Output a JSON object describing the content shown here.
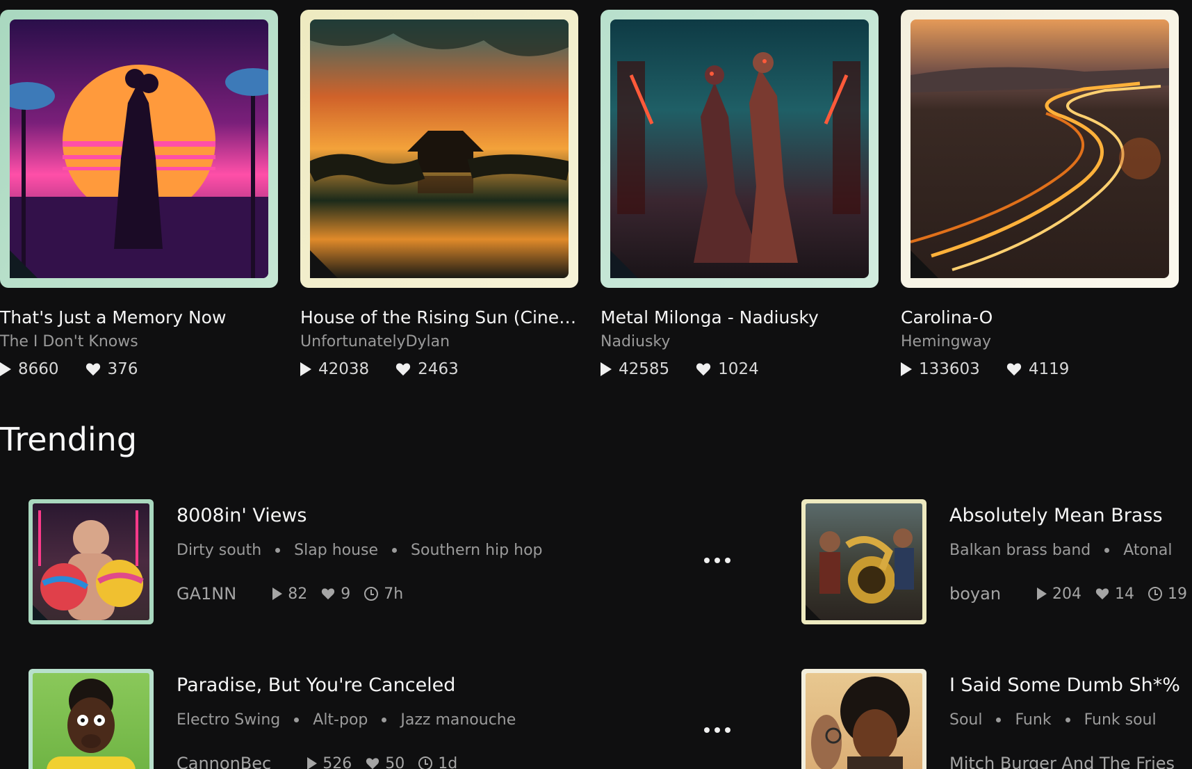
{
  "featured": [
    {
      "title": "That's Just a Memory Now",
      "artist": "The I Don't Knows",
      "plays": "8660",
      "likes": "376",
      "frame": "#a9d8bf",
      "corner": "#101a20"
    },
    {
      "title": "House of the Rising Sun (Cinem...",
      "artist": "UnfortunatelyDylan",
      "plays": "42038",
      "likes": "2463",
      "frame": "#eeeac0",
      "corner": "#121212"
    },
    {
      "title": "Metal Milonga - Nadiusky",
      "artist": "Nadiusky",
      "plays": "42585",
      "likes": "1024",
      "frame": "#b8e0cc",
      "corner": "#101820"
    },
    {
      "title": "Carolina-O",
      "artist": "Hemingway",
      "plays": "133603",
      "likes": "4119",
      "frame": "#f3efdd",
      "corner": "#121212"
    }
  ],
  "trending": {
    "title": "Trending",
    "tracks": [
      {
        "title": "8008in' Views",
        "genres": [
          "Dirty south",
          "Slap house",
          "Southern hip hop"
        ],
        "user": "GA1NN",
        "plays": "82",
        "likes": "9",
        "age": "7h"
      },
      {
        "title": "Absolutely Mean Brass",
        "genres": [
          "Balkan brass band",
          "Atonal"
        ],
        "user": "boyan",
        "plays": "204",
        "likes": "14",
        "age": "19"
      },
      {
        "title": "Paradise, But You're Canceled",
        "genres": [
          "Electro Swing",
          "Alt-pop",
          "Jazz manouche"
        ],
        "user": "CannonBec",
        "plays": "526",
        "likes": "50",
        "age": "1d"
      },
      {
        "title": "I Said Some Dumb Sh*%",
        "genres": [
          "Soul",
          "Funk",
          "Funk soul"
        ],
        "user": "Mitch Burger And The Fries",
        "plays": "",
        "likes": "",
        "age": ""
      }
    ]
  }
}
